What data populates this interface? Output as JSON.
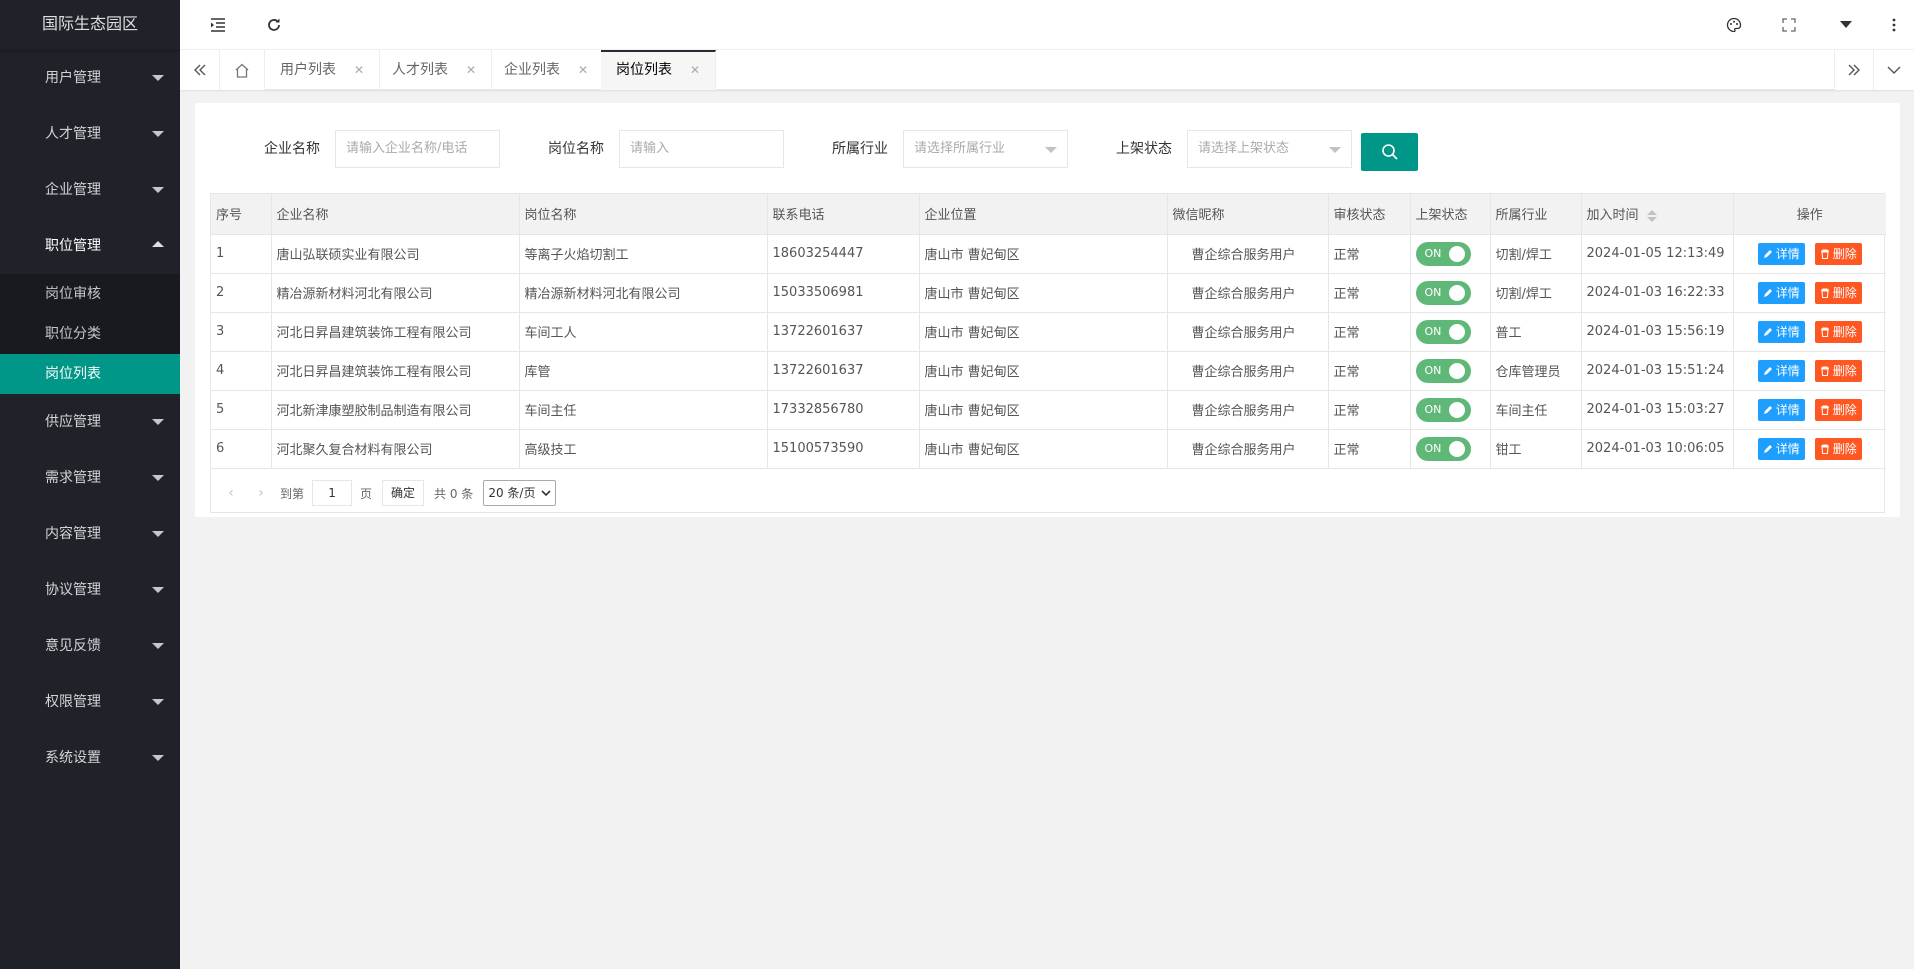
{
  "app": {
    "title": "国际生态园区"
  },
  "sidebar": {
    "items": [
      {
        "label": "用户管理"
      },
      {
        "label": "人才管理"
      },
      {
        "label": "企业管理"
      },
      {
        "label": "职位管理",
        "sub": [
          "岗位审核",
          "职位分类",
          "岗位列表"
        ]
      },
      {
        "label": "供应管理"
      },
      {
        "label": "需求管理"
      },
      {
        "label": "内容管理"
      },
      {
        "label": "协议管理"
      },
      {
        "label": "意见反馈"
      },
      {
        "label": "权限管理"
      },
      {
        "label": "系统设置"
      }
    ]
  },
  "tabs": [
    {
      "label": "用户列表"
    },
    {
      "label": "人才列表"
    },
    {
      "label": "企业列表"
    },
    {
      "label": "岗位列表"
    }
  ],
  "search": {
    "company_label": "企业名称",
    "company_placeholder": "请输入企业名称/电话",
    "job_label": "岗位名称",
    "job_placeholder": "请输入",
    "industry_label": "所属行业",
    "industry_placeholder": "请选择所属行业",
    "status_label": "上架状态",
    "status_placeholder": "请选择上架状态"
  },
  "table": {
    "headers": [
      "序号",
      "企业名称",
      "岗位名称",
      "联系电话",
      "企业位置",
      "微信昵称",
      "审核状态",
      "上架状态",
      "所属行业",
      "加入时间",
      "操作"
    ],
    "rows": [
      {
        "no": "1",
        "company": "唐山弘联硕实业有限公司",
        "job": "等离子火焰切割工",
        "phone": "18603254447",
        "location": "唐山市 曹妃甸区",
        "wechat": "曹企综合服务用户",
        "audit": "正常",
        "shelf": "ON",
        "industry": "切割/焊工",
        "time": "2024-01-05 12:13:49"
      },
      {
        "no": "2",
        "company": "精冶源新材料河北有限公司",
        "job": "精冶源新材料河北有限公司",
        "phone": "15033506981",
        "location": "唐山市 曹妃甸区",
        "wechat": "曹企综合服务用户",
        "audit": "正常",
        "shelf": "ON",
        "industry": "切割/焊工",
        "time": "2024-01-03 16:22:33"
      },
      {
        "no": "3",
        "company": "河北日昇昌建筑装饰工程有限公司",
        "job": "车间工人",
        "phone": "13722601637",
        "location": "唐山市 曹妃甸区",
        "wechat": "曹企综合服务用户",
        "audit": "正常",
        "shelf": "ON",
        "industry": "普工",
        "time": "2024-01-03 15:56:19"
      },
      {
        "no": "4",
        "company": "河北日昇昌建筑装饰工程有限公司",
        "job": "库管",
        "phone": "13722601637",
        "location": "唐山市 曹妃甸区",
        "wechat": "曹企综合服务用户",
        "audit": "正常",
        "shelf": "ON",
        "industry": "仓库管理员",
        "time": "2024-01-03 15:51:24"
      },
      {
        "no": "5",
        "company": "河北新津康塑胶制品制造有限公司",
        "job": "车间主任",
        "phone": "17332856780",
        "location": "唐山市 曹妃甸区",
        "wechat": "曹企综合服务用户",
        "audit": "正常",
        "shelf": "ON",
        "industry": "车间主任",
        "time": "2024-01-03 15:03:27"
      },
      {
        "no": "6",
        "company": "河北聚久复合材料有限公司",
        "job": "高级技工",
        "phone": "15100573590",
        "location": "唐山市 曹妃甸区",
        "wechat": "曹企综合服务用户",
        "audit": "正常",
        "shelf": "ON",
        "industry": "钳工",
        "time": "2024-01-03 10:06:05"
      }
    ],
    "detail_label": "详情",
    "delete_label": "删除"
  },
  "pager": {
    "goto_label": "到第",
    "page_value": "1",
    "page_unit": "页",
    "confirm_label": "确定",
    "total_label": "共 0 条",
    "page_size": "20 条/页"
  },
  "colors": {
    "sidebar_bg": "#20222a",
    "accent": "#009688",
    "switch_on": "#5FB878",
    "detail_btn": "#1E9FFF",
    "delete_btn": "#FF5722"
  }
}
